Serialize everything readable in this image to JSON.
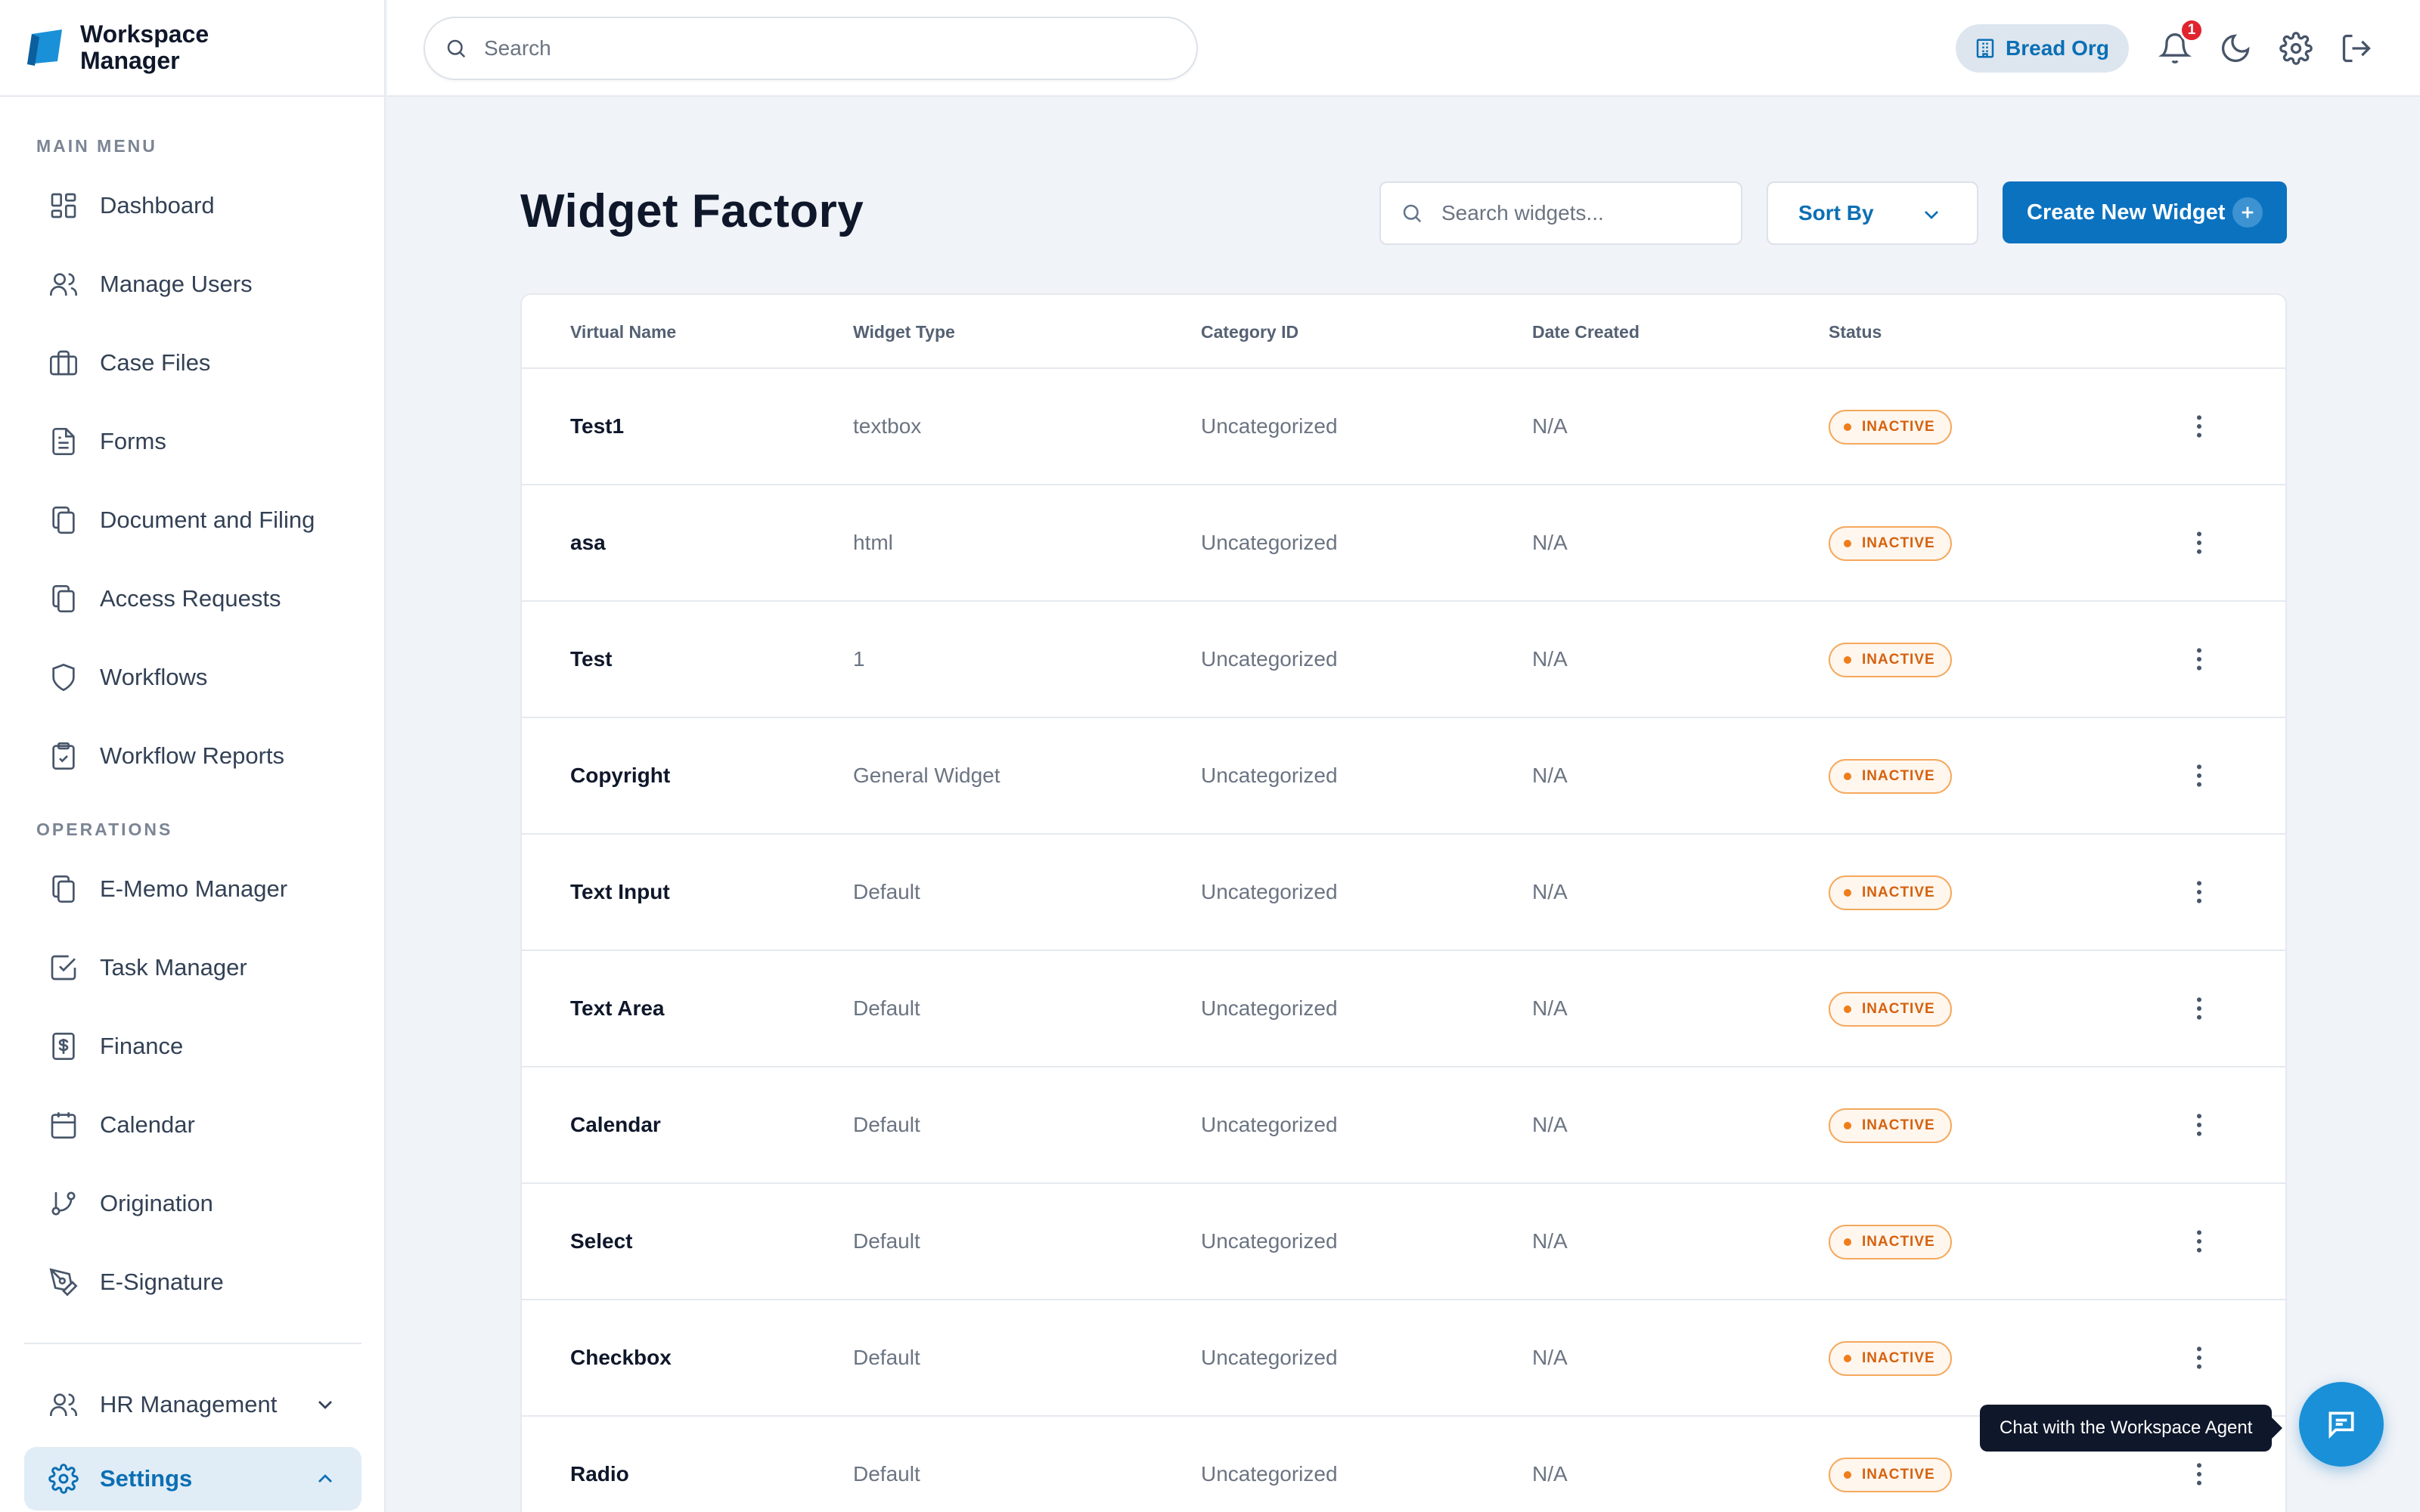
{
  "brand": {
    "line1": "Workspace",
    "line2": "Manager"
  },
  "sidebar": {
    "main_label": "MAIN MENU",
    "main_items": [
      {
        "label": "Dashboard",
        "icon": "dashboard-icon"
      },
      {
        "label": "Manage Users",
        "icon": "users-icon"
      },
      {
        "label": "Case Files",
        "icon": "briefcase-icon"
      },
      {
        "label": "Forms",
        "icon": "document-icon"
      },
      {
        "label": "Document and Filing",
        "icon": "copy-icon"
      },
      {
        "label": "Access Requests",
        "icon": "copy-icon"
      },
      {
        "label": "Workflows",
        "icon": "shield-icon"
      },
      {
        "label": "Workflow Reports",
        "icon": "clipboard-check-icon"
      }
    ],
    "ops_label": "OPERATIONS",
    "ops_items": [
      {
        "label": "E-Memo Manager",
        "icon": "copy-icon"
      },
      {
        "label": "Task Manager",
        "icon": "check-square-icon"
      },
      {
        "label": "Finance",
        "icon": "dollar-icon"
      },
      {
        "label": "Calendar",
        "icon": "calendar-icon"
      },
      {
        "label": "Origination",
        "icon": "git-branch-icon"
      },
      {
        "label": "E-Signature",
        "icon": "pen-tool-icon"
      }
    ],
    "hr": {
      "label": "HR Management",
      "icon": "users-icon"
    },
    "settings": {
      "label": "Settings",
      "icon": "gear-icon"
    }
  },
  "topbar": {
    "search_placeholder": "Search",
    "org_name": "Bread Org",
    "notification_count": "1"
  },
  "main": {
    "title": "Widget Factory",
    "search_placeholder": "Search widgets...",
    "sort_label": "Sort By",
    "create_label": "Create New Widget",
    "columns": [
      "Virtual Name",
      "Widget Type",
      "Category ID",
      "Date Created",
      "Status"
    ],
    "rows": [
      {
        "name": "Test1",
        "type": "textbox",
        "category": "Uncategorized",
        "date": "N/A",
        "status": "INACTIVE"
      },
      {
        "name": "asa",
        "type": "html",
        "category": "Uncategorized",
        "date": "N/A",
        "status": "INACTIVE"
      },
      {
        "name": "Test",
        "type": "1",
        "category": "Uncategorized",
        "date": "N/A",
        "status": "INACTIVE"
      },
      {
        "name": "Copyright",
        "type": "General Widget",
        "category": "Uncategorized",
        "date": "N/A",
        "status": "INACTIVE"
      },
      {
        "name": "Text Input",
        "type": "Default",
        "category": "Uncategorized",
        "date": "N/A",
        "status": "INACTIVE"
      },
      {
        "name": "Text Area",
        "type": "Default",
        "category": "Uncategorized",
        "date": "N/A",
        "status": "INACTIVE"
      },
      {
        "name": "Calendar",
        "type": "Default",
        "category": "Uncategorized",
        "date": "N/A",
        "status": "INACTIVE"
      },
      {
        "name": "Select",
        "type": "Default",
        "category": "Uncategorized",
        "date": "N/A",
        "status": "INACTIVE"
      },
      {
        "name": "Checkbox",
        "type": "Default",
        "category": "Uncategorized",
        "date": "N/A",
        "status": "INACTIVE"
      },
      {
        "name": "Radio",
        "type": "Default",
        "category": "Uncategorized",
        "date": "N/A",
        "status": "INACTIVE"
      }
    ]
  },
  "agent": {
    "tooltip": "Chat with the Workspace Agent"
  },
  "colors": {
    "accent": "#0b72c0",
    "inactive": "#d5620d",
    "notification": "#e0242f"
  }
}
